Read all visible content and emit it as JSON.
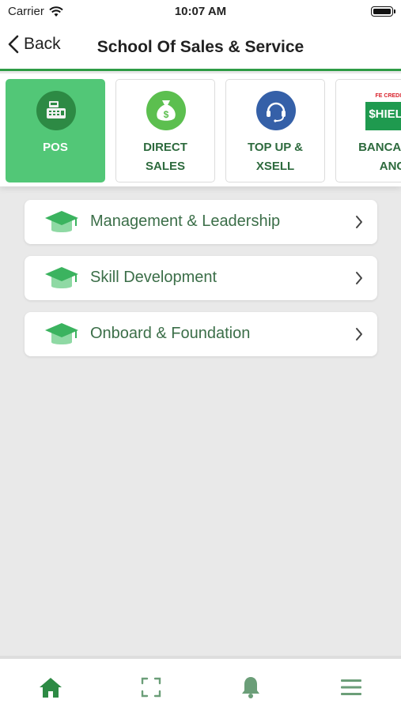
{
  "status_bar": {
    "carrier": "Carrier",
    "time": "10:07 AM"
  },
  "nav": {
    "back_label": "Back",
    "title": "School Of Sales & Service"
  },
  "categories": [
    {
      "label": "POS",
      "icon": "cash-register-icon",
      "active": true
    },
    {
      "label": "DIRECT\nSALES",
      "icon": "money-bag-icon",
      "active": false
    },
    {
      "label": "TOP UP &\nXSELL",
      "icon": "headset-icon",
      "active": false
    },
    {
      "label": "BANCASSUR\nANCE",
      "icon": "shield-logo",
      "active": false,
      "logo_text_top": "FE CREDIT",
      "logo_text_main": "$HIELD"
    }
  ],
  "courses": [
    {
      "label": "Management & Leadership",
      "icon": "graduation-cap-icon"
    },
    {
      "label": "Skill Development",
      "icon": "graduation-cap-icon"
    },
    {
      "label": "Onboard & Foundation",
      "icon": "graduation-cap-icon"
    }
  ],
  "tab_bar": [
    {
      "name": "home",
      "icon": "home-icon",
      "active": true
    },
    {
      "name": "scan",
      "icon": "scan-icon",
      "active": false
    },
    {
      "name": "notifications",
      "icon": "bell-icon",
      "active": false
    },
    {
      "name": "menu",
      "icon": "menu-icon",
      "active": false
    }
  ],
  "colors": {
    "accent": "#2e9c45",
    "active_card": "#52c777",
    "icon_green": "#2d8a44",
    "text_green": "#3b6e48"
  }
}
